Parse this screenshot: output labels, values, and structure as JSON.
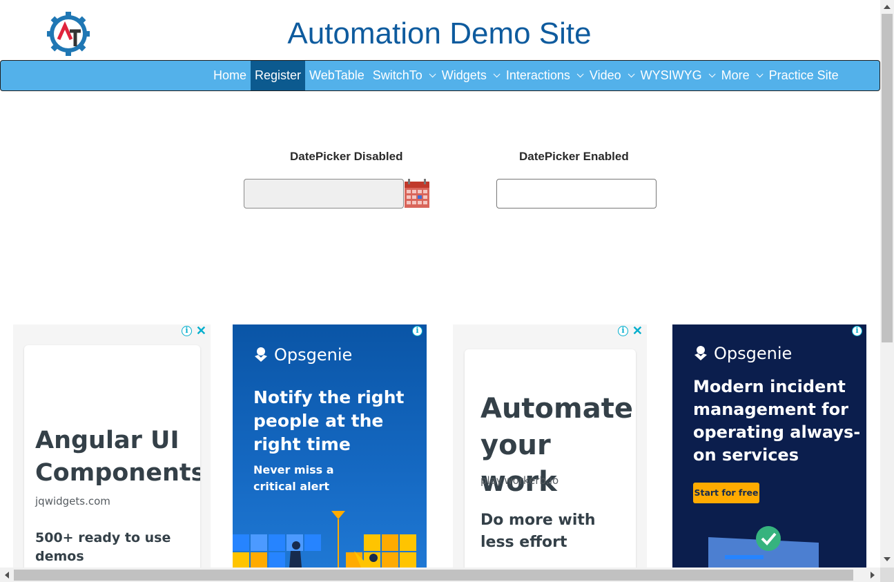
{
  "header": {
    "title": "Automation Demo Site",
    "logo_text": "AT"
  },
  "nav": {
    "items": [
      {
        "label": "Home",
        "dropdown": false,
        "active": false
      },
      {
        "label": "Register",
        "dropdown": false,
        "active": true
      },
      {
        "label": "WebTable",
        "dropdown": false,
        "active": false
      },
      {
        "label": "SwitchTo",
        "dropdown": true,
        "active": false
      },
      {
        "label": "Widgets",
        "dropdown": true,
        "active": false
      },
      {
        "label": "Interactions",
        "dropdown": true,
        "active": false
      },
      {
        "label": "Video",
        "dropdown": true,
        "active": false
      },
      {
        "label": "WYSIWYG",
        "dropdown": true,
        "active": false
      },
      {
        "label": "More",
        "dropdown": true,
        "active": false
      },
      {
        "label": "Practice Site",
        "dropdown": false,
        "active": false
      }
    ]
  },
  "datepickers": {
    "disabled_label": "DatePicker Disabled",
    "enabled_label": "DatePicker Enabled",
    "disabled_value": "",
    "enabled_value": ""
  },
  "ads": {
    "ad1": {
      "headline": "Angular UI Components",
      "domain": "jqwidgets.com",
      "subtext": "500+ ready to use demos"
    },
    "ad2": {
      "brand": "Opsgenie",
      "headline": "Notify the right people at the right time",
      "subtext": "Never miss a critical alert"
    },
    "ad3": {
      "headline": "Automate your work",
      "domain": "play.workerb.io",
      "subtext": "Do more with less effort"
    },
    "ad4": {
      "brand": "Opsgenie",
      "headline": "Modern incident management for operating always-on services",
      "cta": "Start for free"
    }
  },
  "colors": {
    "title": "#0e5b9e",
    "nav_bg": "#53b1ea",
    "nav_active": "#0c5a8f",
    "ad_info": "#00aecd",
    "opsgenie_cta": "#ffab00"
  }
}
